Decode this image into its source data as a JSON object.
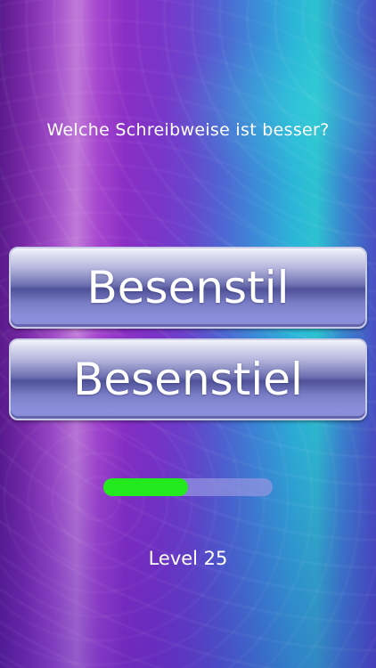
{
  "question": "Welche Schreibweise ist besser?",
  "answers": [
    {
      "label": "Besenstil"
    },
    {
      "label": "Besenstiel"
    }
  ],
  "progress": {
    "fraction": 0.5,
    "fill_color": "#22ea1d",
    "track_color": "#9696e1"
  },
  "level": {
    "text": "Level 25"
  }
}
